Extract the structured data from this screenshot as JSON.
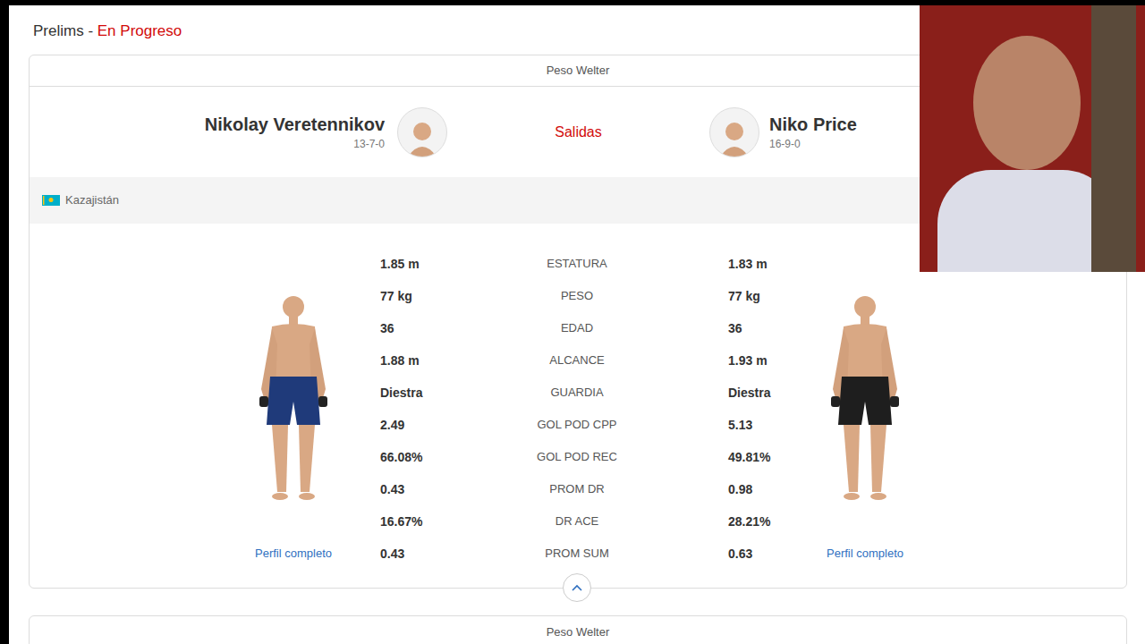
{
  "header": {
    "title": "Prelims",
    "separator": " - ",
    "status": "En Progreso"
  },
  "bout": {
    "weight_class": "Peso Welter",
    "center_label": "Salidas",
    "country": "Kazajistán",
    "fighters": [
      {
        "side": "left",
        "name": "Nikolay Veretennikov",
        "record": "13-7-0",
        "profile_link": "Perfil completo"
      },
      {
        "side": "right",
        "name": "Niko Price",
        "record": "16-9-0",
        "profile_link": "Perfil completo"
      }
    ],
    "stats": [
      {
        "label": "ESTATURA",
        "left": "1.85 m",
        "right": "1.83 m"
      },
      {
        "label": "PESO",
        "left": "77 kg",
        "right": "77 kg"
      },
      {
        "label": "EDAD",
        "left": "36",
        "right": "36"
      },
      {
        "label": "ALCANCE",
        "left": "1.88 m",
        "right": "1.93 m"
      },
      {
        "label": "GUARDIA",
        "left": "Diestra",
        "right": "Diestra"
      },
      {
        "label": "GOL POD CPP",
        "left": "2.49",
        "right": "5.13"
      },
      {
        "label": "GOL POD REC",
        "left": "66.08%",
        "right": "49.81%"
      },
      {
        "label": "PROM DR",
        "left": "0.43",
        "right": "0.98"
      },
      {
        "label": "DR ACE",
        "left": "16.67%",
        "right": "28.21%"
      },
      {
        "label": "PROM SUM",
        "left": "0.43",
        "right": "0.63"
      }
    ],
    "expanded": true
  },
  "next_bout": {
    "weight_class": "Peso Welter"
  }
}
